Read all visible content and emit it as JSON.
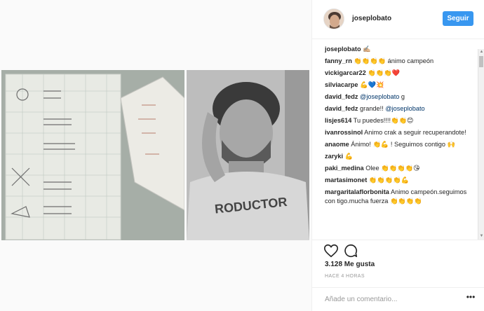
{
  "media": {
    "photo_left": "",
    "photo_right": ""
  },
  "header": {
    "username": "joseplobato",
    "follow_label": "Seguir"
  },
  "comments": [
    {
      "user": "joseplobato",
      "text": "✍🏼"
    },
    {
      "user": "fanny_rn",
      "text": "👏👏👏👏 ánimo campeón"
    },
    {
      "user": "vickigarcar22",
      "text": "👏👏👏❤️"
    },
    {
      "user": "silviacarpe",
      "text": "💪💙💥"
    },
    {
      "user": "david_fedz",
      "mention": "@joseplobato",
      "text": " g"
    },
    {
      "user": "david_fedz",
      "text": "grande!! ",
      "mention": "@joseplobato"
    },
    {
      "user": "lisjes614",
      "text": "Tu puedes!!!!👏👏😊"
    },
    {
      "user": "ivanrossinol",
      "text": "Animo crak a seguir recuperandote!"
    },
    {
      "user": "anaome",
      "text": "Ánimo! 👏💪 ! Seguimos contigo 🙌"
    },
    {
      "user": "zaryki",
      "text": "💪"
    },
    {
      "user": "paki_medina",
      "text": "Olee 👏👏👏👏😘"
    },
    {
      "user": "martasimonet",
      "text": "👏👏👏👏💪"
    },
    {
      "user": "margaritalaflorbonita",
      "text": "Animo campeón.seguimos con tigo.mucha fuerza 👏👏👏👏"
    }
  ],
  "actions": {
    "likes": "3.128 Me gusta",
    "time": "HACE 4 HORAS",
    "add_comment_placeholder": "Añade un comentario...",
    "more": "•••"
  },
  "colors": {
    "accent": "#3897f0",
    "mention": "#003569"
  }
}
